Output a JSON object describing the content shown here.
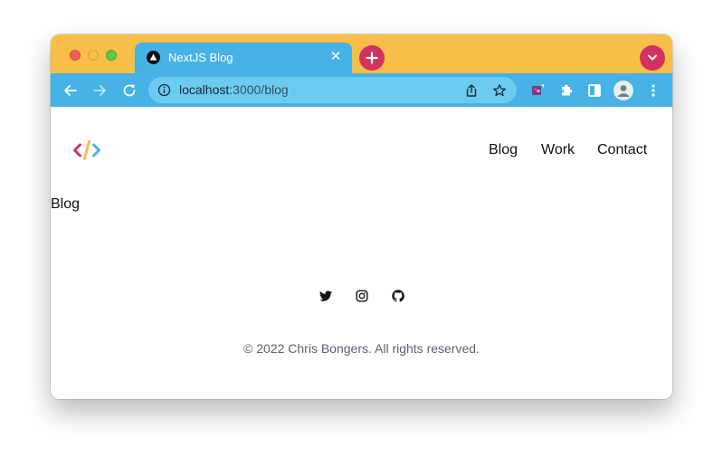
{
  "browser": {
    "tab": {
      "title": "NextJS Blog",
      "favicon": "nextjs-triangle-icon",
      "close_glyph": "✕"
    },
    "address_bar": {
      "host": "localhost",
      "path": ":3000/blog"
    },
    "colors": {
      "titlebar": "#f7be48",
      "toolbar": "#46b2e6",
      "omnibox": "#6ccbf0",
      "accent": "#d2325f"
    }
  },
  "site": {
    "nav": {
      "links": [
        {
          "label": "Blog"
        },
        {
          "label": "Work"
        },
        {
          "label": "Contact"
        }
      ]
    },
    "page_heading": "Blog",
    "footer": {
      "social": [
        "twitter-icon",
        "instagram-icon",
        "github-icon"
      ],
      "copyright": "© 2022 Chris Bongers. All rights reserved."
    }
  }
}
